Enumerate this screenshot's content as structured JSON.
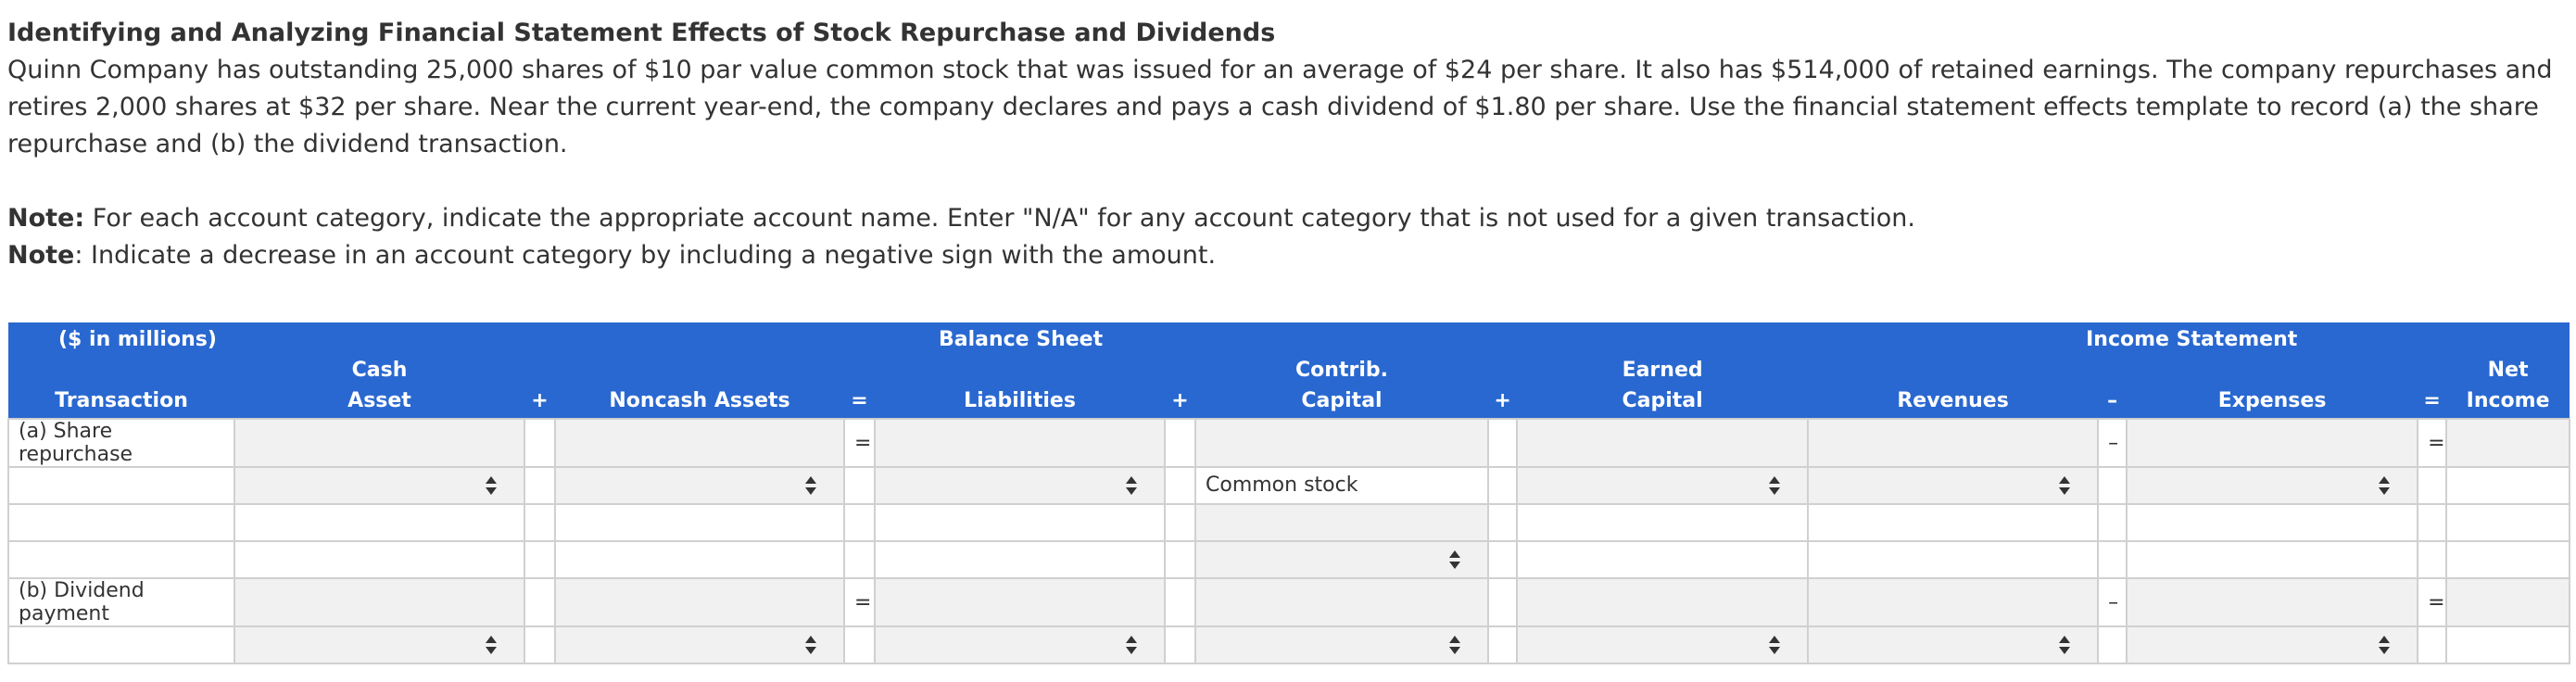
{
  "problem": {
    "title": "Identifying and Analyzing Financial Statement Effects of Stock Repurchase and Dividends",
    "body": "Quinn Company has outstanding 25,000 shares of $10 par value common stock that was issued for an average of $24 per share. It also has $514,000 of retained earnings. The company repurchases and retires 2,000 shares at $32 per share. Near the current year-end, the company declares and pays a cash dividend of $1.80 per share. Use the financial statement effects template to record (a) the share repurchase and (b) the dividend transaction.",
    "note1_label": "Note:",
    "note1_text": " For each account category, indicate the appropriate account name. Enter \"N/A\" for any account category that is not used for a given transaction.",
    "note2_label": "Note",
    "note2_text": ": Indicate a decrease in an account category by including a negative sign with the amount."
  },
  "template": {
    "header_top": {
      "units": "($ in millions)",
      "balance_sheet": "Balance Sheet",
      "income_statement": "Income Statement"
    },
    "header_cols": {
      "transaction": "Transaction",
      "cash_asset_l1": "Cash",
      "cash_asset_l2": "Asset",
      "plus1": "+",
      "noncash_assets": "Noncash Assets",
      "equals1": "=",
      "liabilities": "Liabilities",
      "plus2": "+",
      "contrib_l1": "Contrib.",
      "contrib_l2": "Capital",
      "plus3": "+",
      "earned_l1": "Earned",
      "earned_l2": "Capital",
      "revenues": "Revenues",
      "minus": "–",
      "expenses": "Expenses",
      "equals2": "=",
      "net_l1": "Net",
      "net_l2": "Income"
    },
    "operators": {
      "equals": "=",
      "minus": "–"
    },
    "rows": {
      "a_label": "(a) Share repurchase",
      "b_label": "(b) Dividend payment",
      "common_stock": "Common stock"
    }
  },
  "colors": {
    "header_bg": "#2968d0",
    "input_bg": "#f1f1f1",
    "border": "#d0d0d0"
  }
}
